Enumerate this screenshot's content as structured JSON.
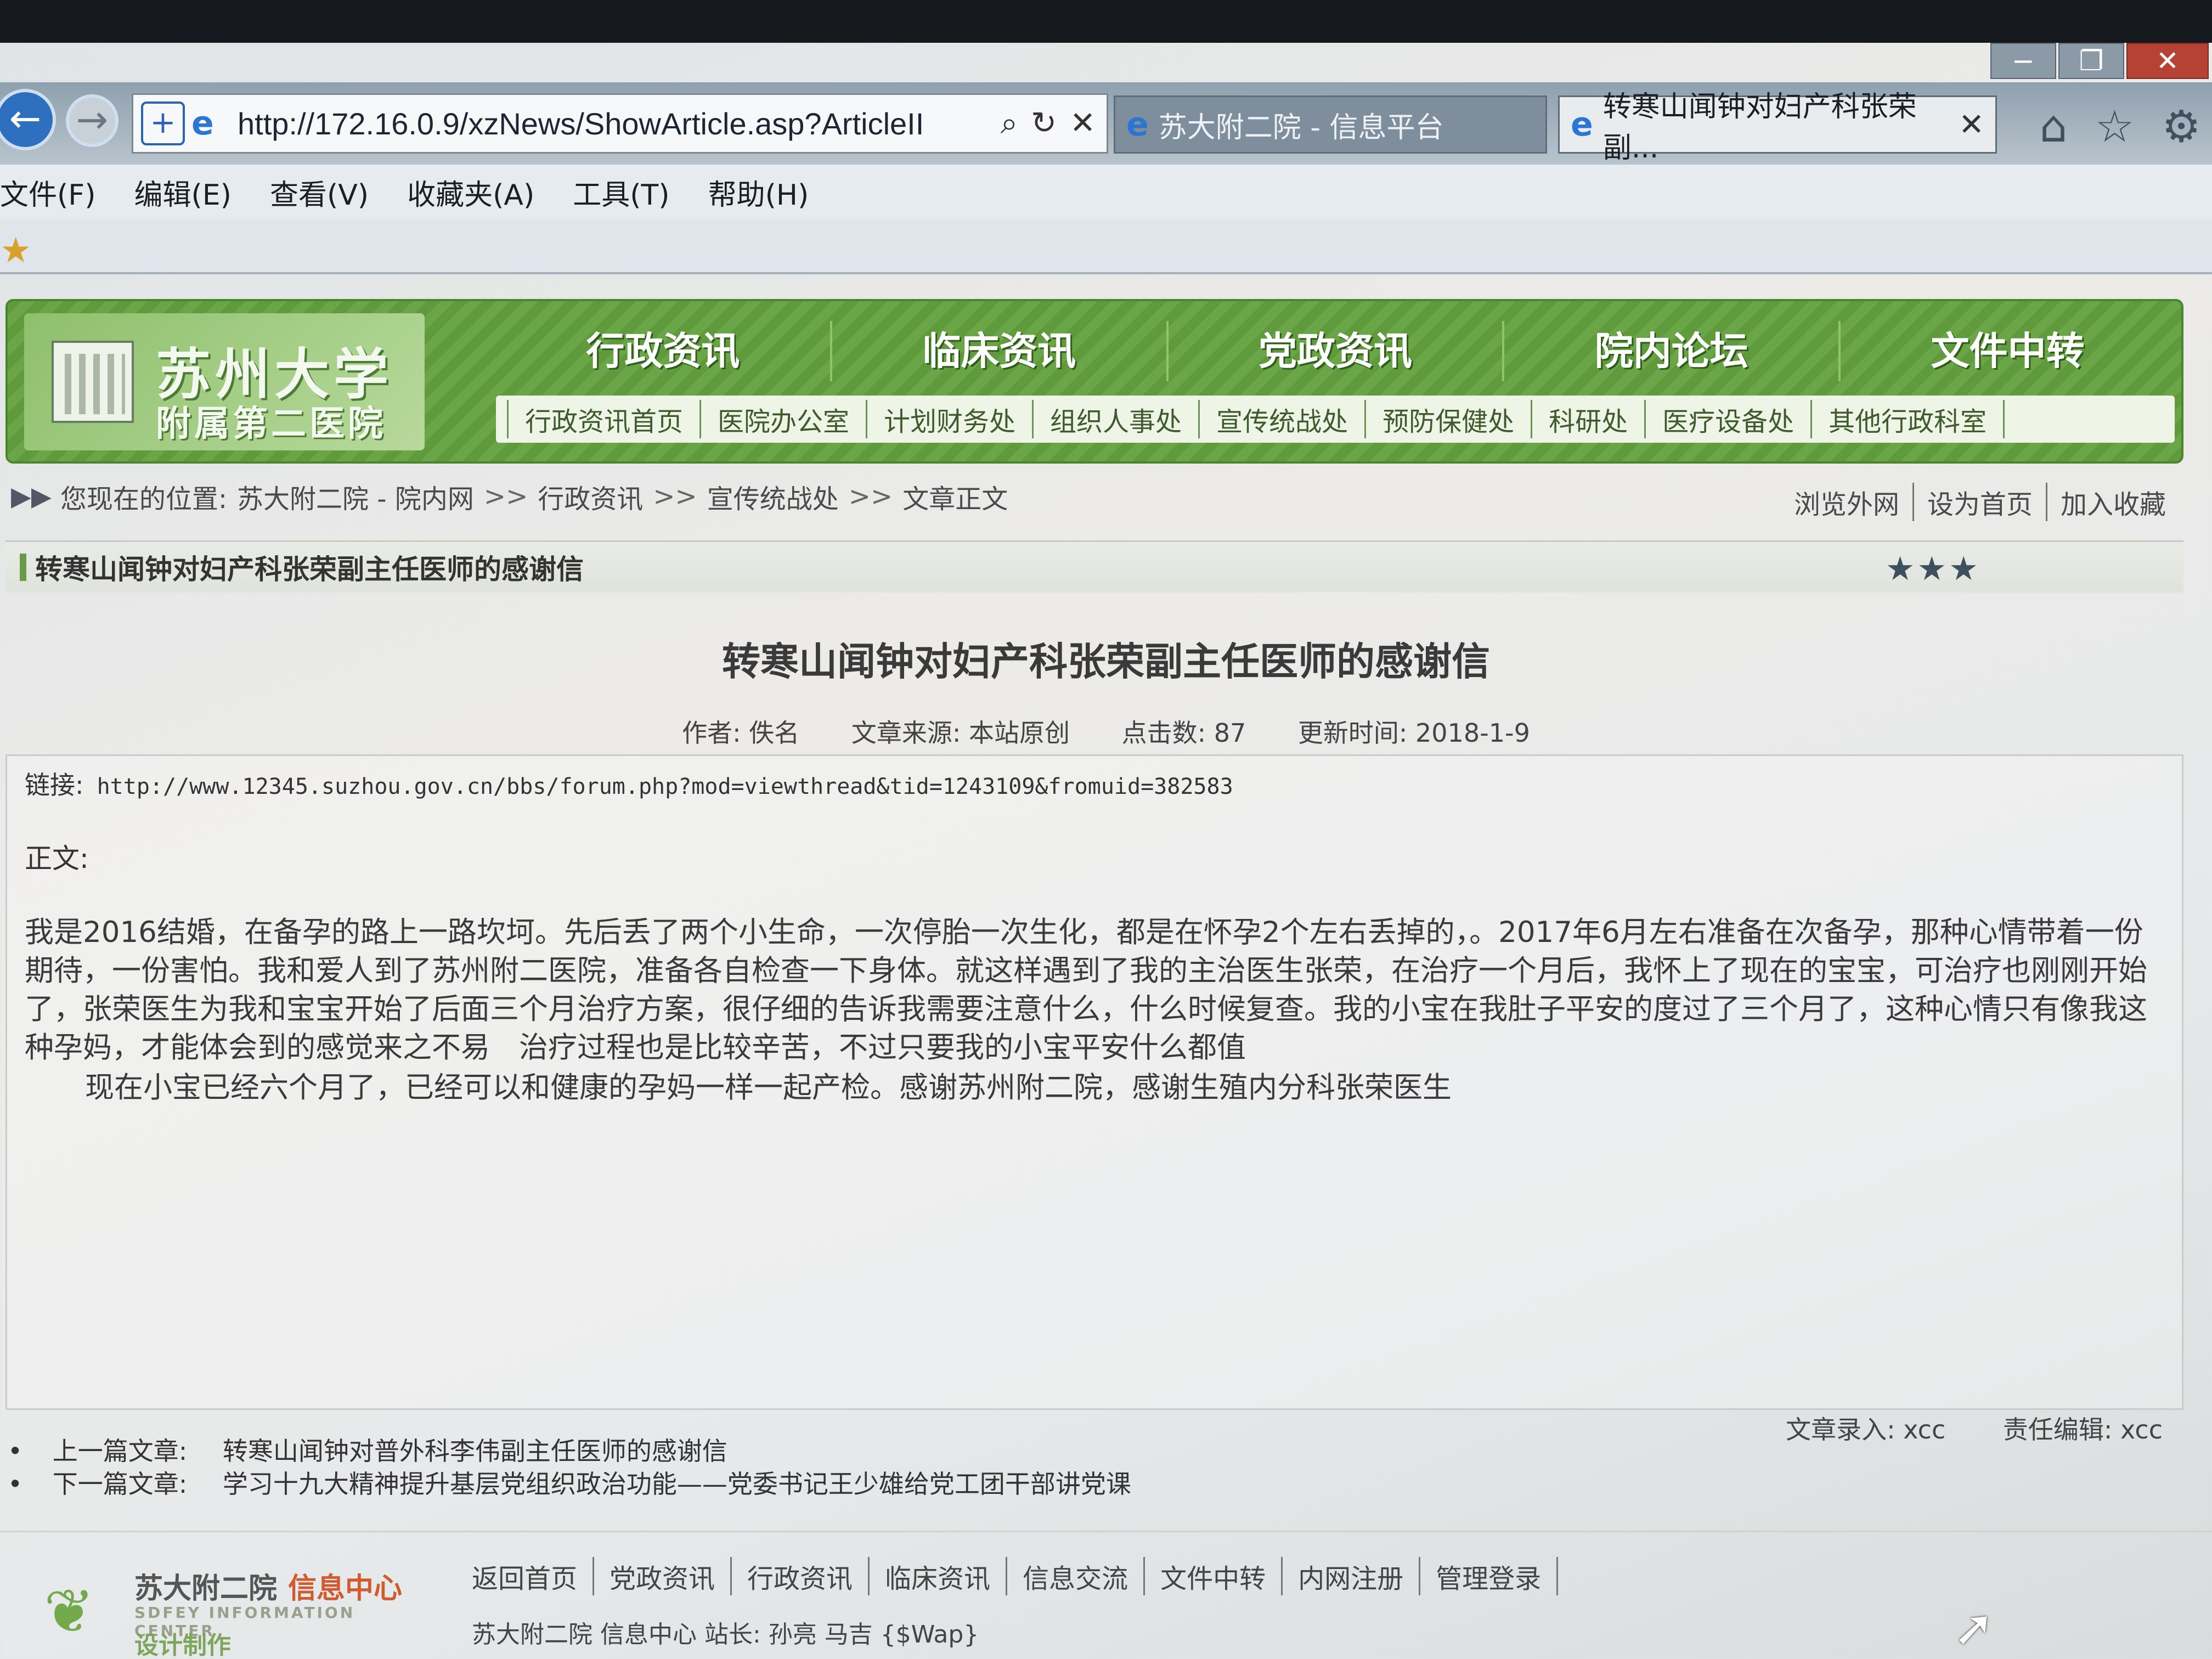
{
  "browser": {
    "url": "http://172.16.0.9/xzNews/ShowArticle.asp?ArticleII",
    "tabs": [
      {
        "label": "苏大附二院 - 信息平台"
      },
      {
        "label": "转寒山闻钟对妇产科张荣副..."
      }
    ],
    "menu": [
      "文件(F)",
      "编辑(E)",
      "查看(V)",
      "收藏夹(A)",
      "工具(T)",
      "帮助(H)"
    ]
  },
  "site": {
    "logo_line1": "苏州大学",
    "logo_line2": "附属第二医院",
    "main_nav": [
      "行政资讯",
      "临床资讯",
      "党政资讯",
      "院内论坛",
      "文件中转"
    ],
    "sub_nav": [
      "行政资讯首页",
      "医院办公室",
      "计划财务处",
      "组织人事处",
      "宣传统战处",
      "预防保健处",
      "科研处",
      "医疗设备处",
      "其他行政科室"
    ]
  },
  "breadcrumb": {
    "label": "您现在的位置:",
    "items": [
      "苏大附二院 - 院内网",
      "行政资讯",
      "宣传统战处",
      "文章正文"
    ],
    "separator": ">>"
  },
  "top_links": [
    "浏览外网",
    "设为首页",
    "加入收藏"
  ],
  "article": {
    "bar_title": "转寒山闻钟对妇产科张荣副主任医师的感谢信",
    "stars": "★★★",
    "title": "转寒山闻钟对妇产科张荣副主任医师的感谢信",
    "meta": {
      "author": "作者: 佚名",
      "source": "文章来源: 本站原创",
      "clicks": "点击数: 87",
      "updated": "更新时间: 2018-1-9"
    },
    "link_label": "链接:",
    "link_url": "http://www.12345.suzhou.gov.cn/bbs/forum.php?mod=viewthread&tid=1243109&fromuid=382583",
    "body_label": "正文:",
    "paragraph1": "我是2016结婚，在备孕的路上一路坎坷。先后丢了两个小生命，一次停胎一次生化，都是在怀孕2个左右丢掉的，。2017年6月左右准备在次备孕，那种心情带着一份期待，一份害怕。我和爱人到了苏州附二医院，准备各自检查一下身体。就这样遇到了我的主治医生张荣，在治疗一个月后，我怀上了现在的宝宝，可治疗也刚刚开始了，张荣医生为我和宝宝开始了后面三个月治疗方案，很仔细的告诉我需要注意什么，什么时候复查。我的小宝在我肚子平安的度过了三个月了，这种心情只有像我这种孕妈，才能体会到的感觉来之不易　治疗过程也是比较辛苦，不过只要我的小宝平安什么都值",
    "paragraph2": "现在小宝已经六个月了，已经可以和健康的孕妈一样一起产检。感谢苏州附二院，感谢生殖内分科张荣医生",
    "entry_by": "文章录入: xcc",
    "editor": "责任编辑: xcc"
  },
  "prev_next": {
    "prev_label": "上一篇文章:",
    "prev_title": "转寒山闻钟对普外科李伟副主任医师的感谢信",
    "next_label": "下一篇文章:",
    "next_title": "学习十九大精神提升基层党组织政治功能——党委书记王少雄给党工团干部讲党课"
  },
  "footer": {
    "logo_main": "苏大附二院",
    "logo_accent": "信息中心",
    "logo_en": "SDFEY INFORMATION CENTER",
    "logo_design": "设计制作",
    "links": [
      "返回首页",
      "党政资讯",
      "行政资讯",
      "临床资讯",
      "信息交流",
      "文件中转",
      "内网注册",
      "管理登录"
    ],
    "credit": "苏大附二院 信息中心 站长: 孙亮 马吉 {$Wap}"
  }
}
